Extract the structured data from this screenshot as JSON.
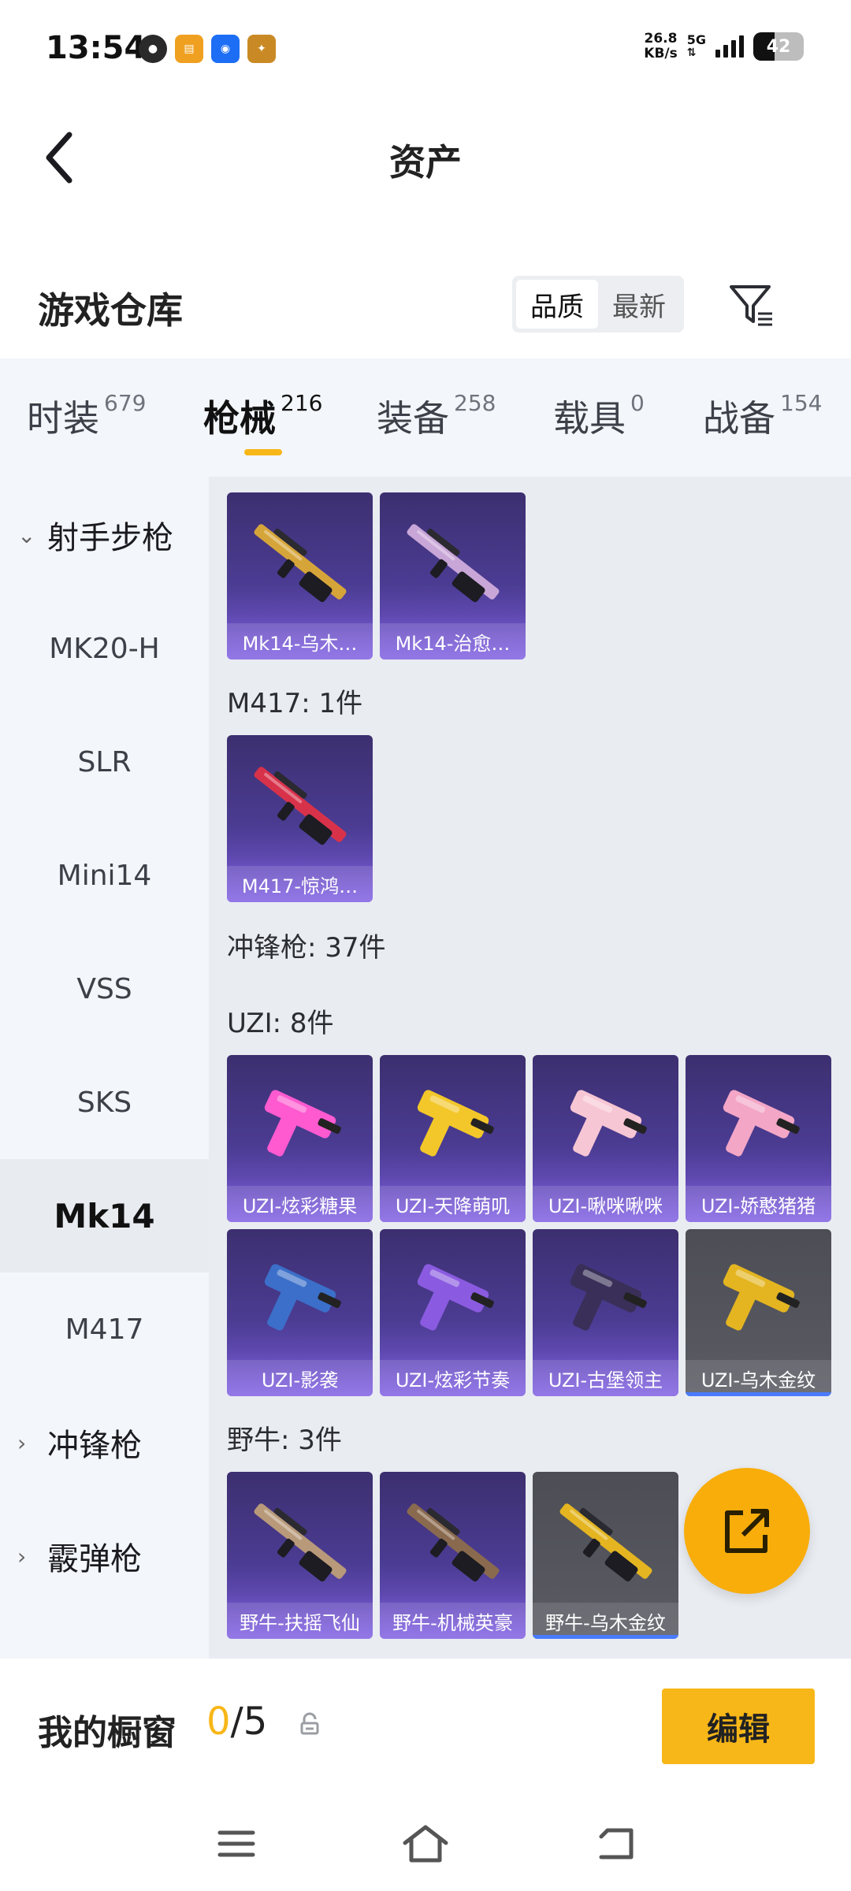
{
  "status_bar": {
    "time": "13:54",
    "apps": [
      "app-1",
      "app-2",
      "app-3",
      "app-4"
    ],
    "speed_value": "26.8",
    "speed_unit": "KB/s",
    "network": "5G",
    "battery": "42"
  },
  "header": {
    "title": "资产"
  },
  "warehouse": {
    "title": "游戏仓库",
    "sort_options": [
      "品质",
      "最新"
    ],
    "sort_selected": "品质"
  },
  "tabs": [
    {
      "label": "时装",
      "count": "679"
    },
    {
      "label": "枪械",
      "count": "216"
    },
    {
      "label": "装备",
      "count": "258"
    },
    {
      "label": "载具",
      "count": "0"
    },
    {
      "label": "战备",
      "count": "154"
    }
  ],
  "active_tab": "枪械",
  "sidebar": {
    "items": [
      {
        "label": "射手步枪",
        "type": "category",
        "expanded": true
      },
      {
        "label": "MK20-H",
        "type": "item"
      },
      {
        "label": "SLR",
        "type": "item"
      },
      {
        "label": "Mini14",
        "type": "item"
      },
      {
        "label": "VSS",
        "type": "item"
      },
      {
        "label": "SKS",
        "type": "item"
      },
      {
        "label": "Mk14",
        "type": "item",
        "selected": true
      },
      {
        "label": "M417",
        "type": "item"
      },
      {
        "label": "冲锋枪",
        "type": "category",
        "expanded": false
      },
      {
        "label": "霰弹枪",
        "type": "category",
        "expanded": false
      }
    ]
  },
  "content": {
    "mk14_items": [
      {
        "name": "Mk14-乌木…",
        "gun_color": "#d6a53a"
      },
      {
        "name": "Mk14-治愈…",
        "gun_color": "#c9a6d8"
      }
    ],
    "m417_label": "M417: 1件",
    "m417_items": [
      {
        "name": "M417-惊鸿…",
        "gun_color": "#d8324a"
      }
    ],
    "smg_label": "冲锋枪: 37件",
    "uzi_label": "UZI: 8件",
    "uzi_items": [
      {
        "name": "UZI-炫彩糖果",
        "gun_color": "#ff5ad0"
      },
      {
        "name": "UZI-天降萌叽",
        "gun_color": "#f3c72a"
      },
      {
        "name": "UZI-啾咪啾咪",
        "gun_color": "#f7c6d4"
      },
      {
        "name": "UZI-娇憨猪猪",
        "gun_color": "#f3a6c6"
      },
      {
        "name": "UZI-影袭",
        "gun_color": "#3b6fc9"
      },
      {
        "name": "UZI-炫彩节奏",
        "gun_color": "#8a5be0"
      },
      {
        "name": "UZI-古堡领主",
        "gun_color": "#3a2f58"
      },
      {
        "name": "UZI-乌木金纹",
        "gun_color": "#e4b521",
        "gray": true
      }
    ],
    "bison_label": "野牛: 3件",
    "bison_items": [
      {
        "name": "野牛-扶摇飞仙",
        "gun_color": "#b89a7a"
      },
      {
        "name": "野牛-机械英豪",
        "gun_color": "#8a6a4e"
      },
      {
        "name": "野牛-乌木金纹",
        "gun_color": "#e4b521",
        "gray": true
      }
    ]
  },
  "showcase": {
    "label": "我的橱窗",
    "current": "0",
    "total": "/5",
    "edit_label": "编辑"
  },
  "colors": {
    "accent": "#f8b718",
    "fab": "#f8ad0b",
    "panel_bg": "#f3f6fa",
    "content_bg": "#e9ecf1"
  },
  "icons": [
    "back-arrow-icon",
    "filter-icon",
    "chevron-down-icon",
    "chevron-right-icon",
    "share-icon",
    "lock-icon",
    "menu-icon",
    "home-icon",
    "return-icon"
  ]
}
